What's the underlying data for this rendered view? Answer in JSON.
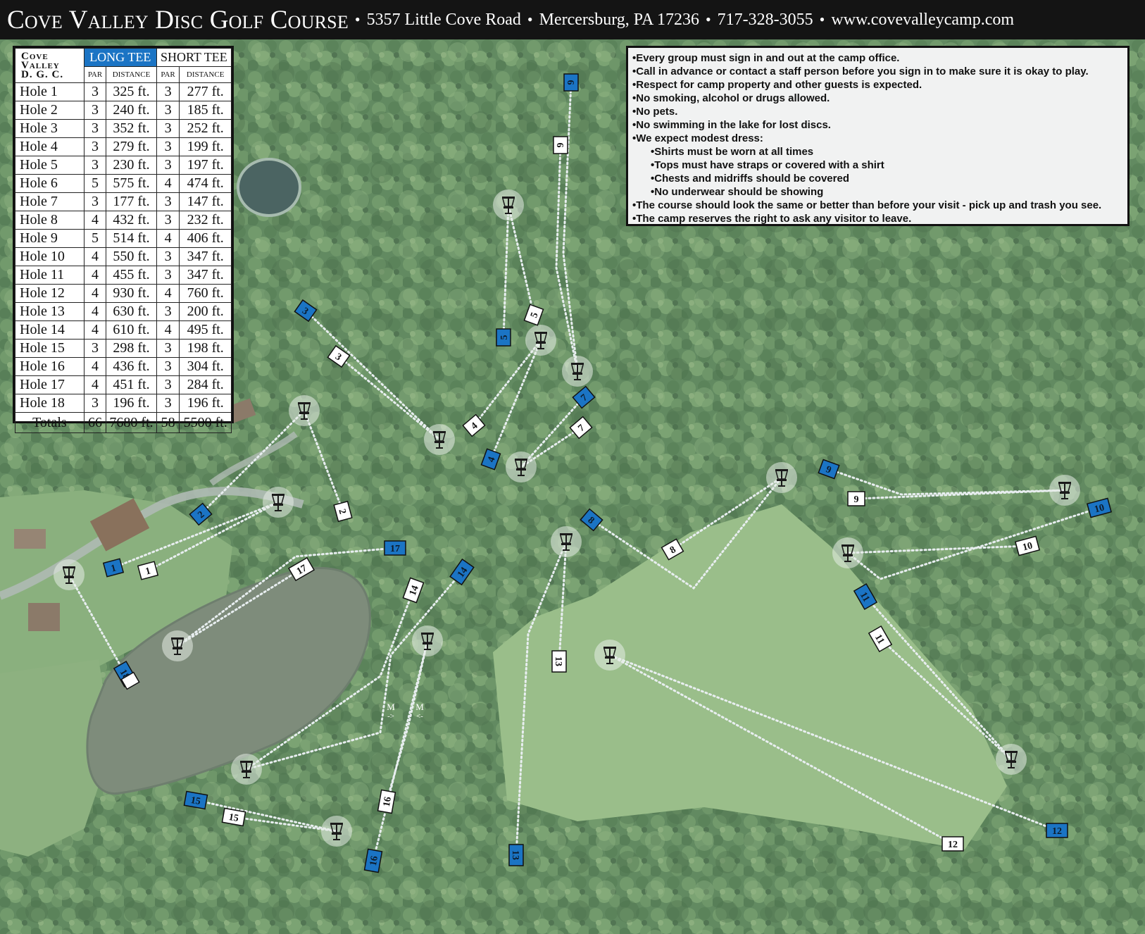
{
  "header": {
    "title": "Cove Valley Disc Golf Course",
    "address": "5357 Little Cove Road",
    "city": "Mercersburg, PA 17236",
    "phone": "717-328-3055",
    "website": "www.covevalleycamp.com",
    "separator": "•"
  },
  "scorecard": {
    "logo_lines": [
      "Cove",
      "Valley",
      "D. G. C."
    ],
    "long_tee_label": "LONG TEE",
    "short_tee_label": "SHORT TEE",
    "par_label": "PAR",
    "distance_label": "DISTANCE",
    "holes": [
      {
        "hole": "Hole 1",
        "long_par": "3",
        "long_dist": "325 ft.",
        "short_par": "3",
        "short_dist": "277 ft."
      },
      {
        "hole": "Hole 2",
        "long_par": "3",
        "long_dist": "240 ft.",
        "short_par": "3",
        "short_dist": "185 ft."
      },
      {
        "hole": "Hole 3",
        "long_par": "3",
        "long_dist": "352 ft.",
        "short_par": "3",
        "short_dist": "252 ft."
      },
      {
        "hole": "Hole 4",
        "long_par": "3",
        "long_dist": "279 ft.",
        "short_par": "3",
        "short_dist": "199 ft."
      },
      {
        "hole": "Hole 5",
        "long_par": "3",
        "long_dist": "230 ft.",
        "short_par": "3",
        "short_dist": "197 ft."
      },
      {
        "hole": "Hole 6",
        "long_par": "5",
        "long_dist": "575 ft.",
        "short_par": "4",
        "short_dist": "474 ft."
      },
      {
        "hole": "Hole 7",
        "long_par": "3",
        "long_dist": "177 ft.",
        "short_par": "3",
        "short_dist": "147 ft."
      },
      {
        "hole": "Hole 8",
        "long_par": "4",
        "long_dist": "432 ft.",
        "short_par": "3",
        "short_dist": "232 ft."
      },
      {
        "hole": "Hole 9",
        "long_par": "5",
        "long_dist": "514 ft.",
        "short_par": "4",
        "short_dist": "406 ft."
      },
      {
        "hole": "Hole 10",
        "long_par": "4",
        "long_dist": "550 ft.",
        "short_par": "3",
        "short_dist": "347 ft."
      },
      {
        "hole": "Hole 11",
        "long_par": "4",
        "long_dist": "455 ft.",
        "short_par": "3",
        "short_dist": "347 ft."
      },
      {
        "hole": "Hole 12",
        "long_par": "4",
        "long_dist": "930 ft.",
        "short_par": "4",
        "short_dist": "760 ft."
      },
      {
        "hole": "Hole 13",
        "long_par": "4",
        "long_dist": "630 ft.",
        "short_par": "3",
        "short_dist": "200 ft."
      },
      {
        "hole": "Hole 14",
        "long_par": "4",
        "long_dist": "610 ft.",
        "short_par": "4",
        "short_dist": "495 ft."
      },
      {
        "hole": "Hole 15",
        "long_par": "3",
        "long_dist": "298 ft.",
        "short_par": "3",
        "short_dist": "198 ft."
      },
      {
        "hole": "Hole 16",
        "long_par": "4",
        "long_dist": "436 ft.",
        "short_par": "3",
        "short_dist": "304 ft."
      },
      {
        "hole": "Hole 17",
        "long_par": "4",
        "long_dist": "451 ft.",
        "short_par": "3",
        "short_dist": "284 ft."
      },
      {
        "hole": "Hole 18",
        "long_par": "3",
        "long_dist": "196 ft.",
        "short_par": "3",
        "short_dist": "196 ft."
      }
    ],
    "totals": {
      "label": "Totals",
      "long_par": "66",
      "long_dist": "7680 ft.",
      "short_par": "58",
      "short_dist": "5500 ft."
    }
  },
  "rules": [
    {
      "text": "•Every group must sign in and out at the camp office.",
      "indent": false
    },
    {
      "text": "•Call in advance or contact a staff person before you sign in to make sure it is okay to play.",
      "indent": false
    },
    {
      "text": "•Respect for camp property and other guests is expected.",
      "indent": false
    },
    {
      "text": "•No smoking, alcohol or drugs allowed.",
      "indent": false
    },
    {
      "text": "•No pets.",
      "indent": false
    },
    {
      "text": "•No swimming in the lake for lost discs.",
      "indent": false
    },
    {
      "text": "•We expect modest dress:",
      "indent": false
    },
    {
      "text": "•Shirts must be worn at all times",
      "indent": true
    },
    {
      "text": "•Tops must have straps or covered with a shirt",
      "indent": true
    },
    {
      "text": "•Chests and midriffs should be covered",
      "indent": true
    },
    {
      "text": "•No underwear should be showing",
      "indent": true
    },
    {
      "text": "•The course should look the same or better than before your visit - pick up and trash you see.",
      "indent": false
    },
    {
      "text": "•The camp reserves the right to ask any visitor to leave.",
      "indent": false
    }
  ],
  "map": {
    "long_tee_color": "#1b74c4",
    "short_tee_color": "#ffffff",
    "path_color": "#e8eef0",
    "basket_icon": "disc-golf-basket-icon",
    "mando_markers": [
      {
        "letter": "M",
        "arrow": "->"
      },
      {
        "letter": "M",
        "arrow": "<-"
      }
    ],
    "holes": [
      {
        "number": "1"
      },
      {
        "number": "2"
      },
      {
        "number": "3"
      },
      {
        "number": "4"
      },
      {
        "number": "5"
      },
      {
        "number": "6"
      },
      {
        "number": "7"
      },
      {
        "number": "8"
      },
      {
        "number": "9"
      },
      {
        "number": "10"
      },
      {
        "number": "11"
      },
      {
        "number": "12"
      },
      {
        "number": "13"
      },
      {
        "number": "14"
      },
      {
        "number": "15"
      },
      {
        "number": "16"
      },
      {
        "number": "17"
      },
      {
        "number": "18"
      }
    ]
  }
}
